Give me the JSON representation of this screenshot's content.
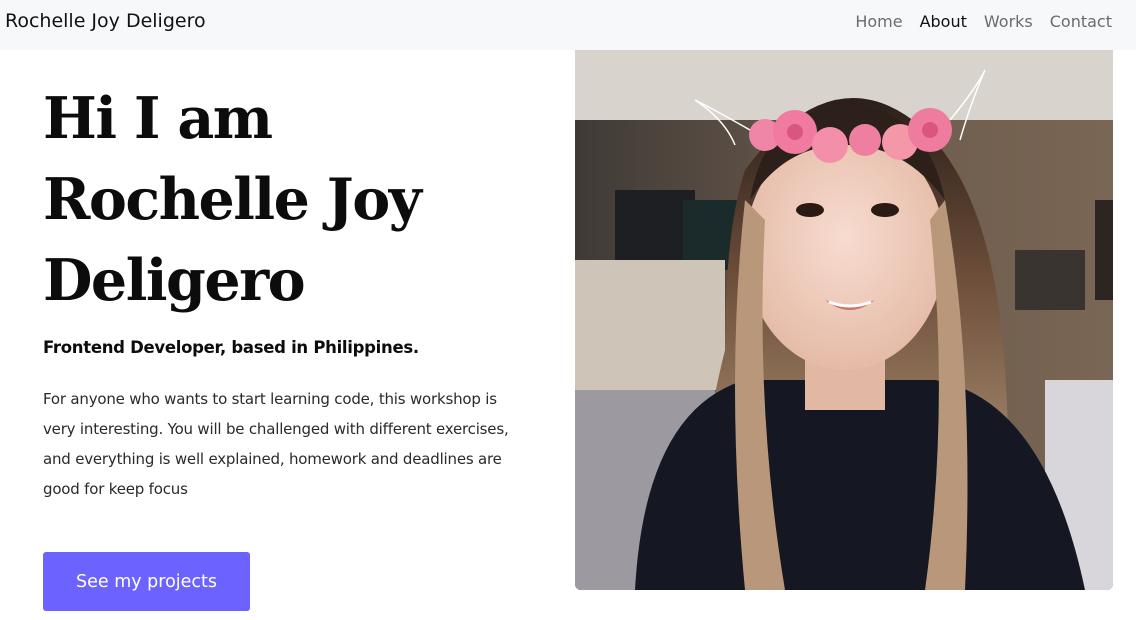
{
  "nav": {
    "brand": "Rochelle Joy Deligero",
    "links": [
      {
        "label": "Home",
        "active": false
      },
      {
        "label": "About",
        "active": true
      },
      {
        "label": "Works",
        "active": false
      },
      {
        "label": "Contact",
        "active": false
      }
    ]
  },
  "hero": {
    "title_line1": "Hi I am",
    "title_line2": "Rochelle Joy",
    "title_line3": "Deligero",
    "subtitle": "Frontend Developer, based in Philippines.",
    "description": "For anyone who wants to start learning code, this workshop is very interesting. You will be challenged with different exercises, and everything is well explained, homework and deadlines are good for keep focus",
    "cta_label": "See my projects"
  },
  "colors": {
    "accent": "#6c63ff",
    "navbar_bg": "#f7f8fa"
  },
  "photo": {
    "subject": "profile-photo"
  }
}
